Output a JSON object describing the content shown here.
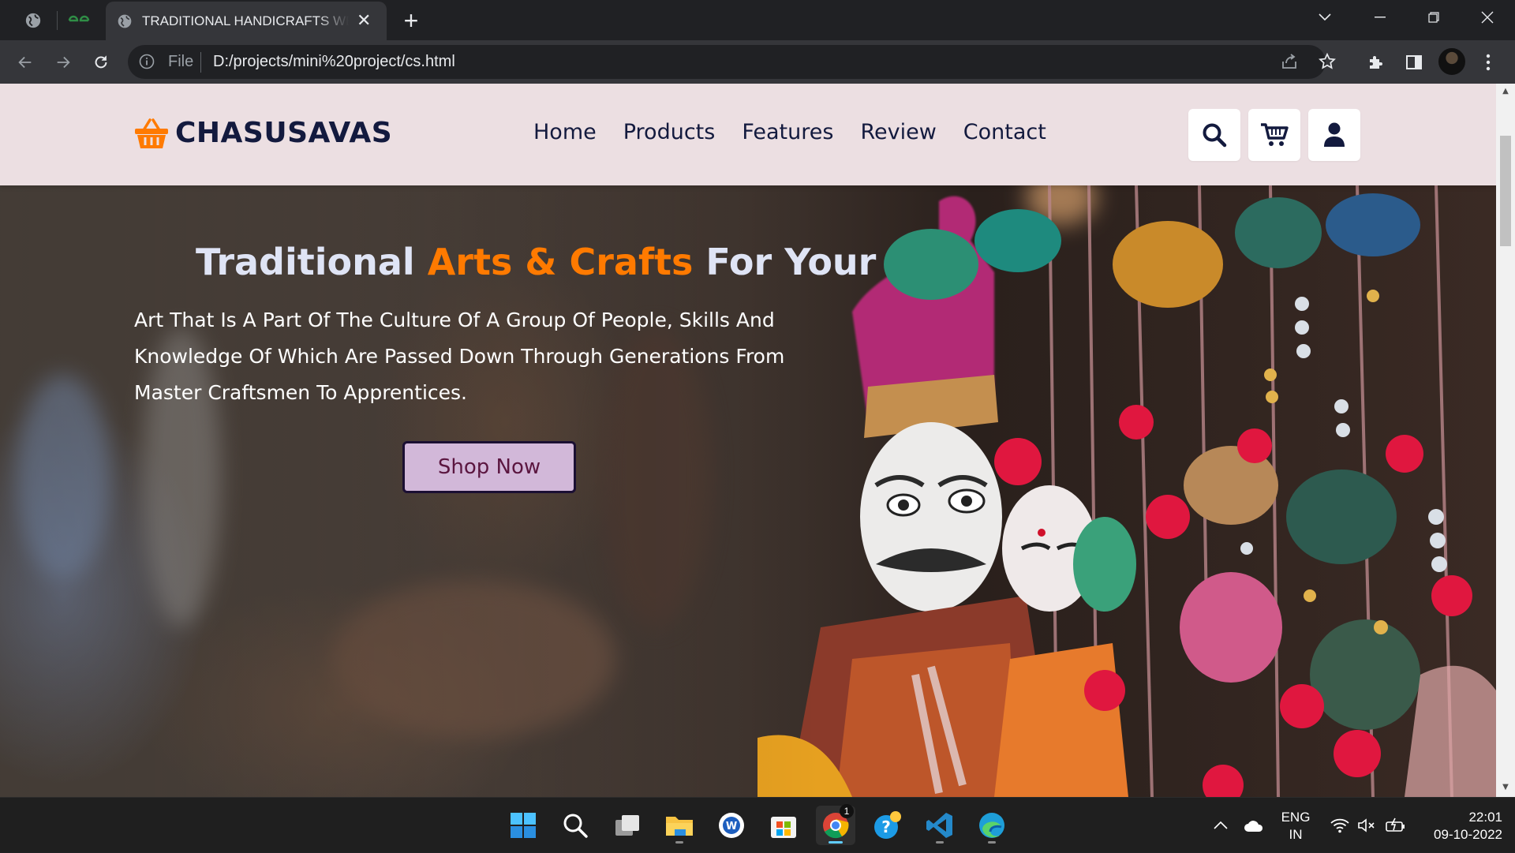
{
  "browser": {
    "active_tab": {
      "title": "TRADITIONAL HANDICRAFTS WEBSITE",
      "favicon": "globe-icon"
    },
    "address": {
      "scheme_label": "File",
      "url": "D:/projects/mini%20project/cs.html"
    }
  },
  "site": {
    "brand": "CHASUSAVAS",
    "nav": [
      "Home",
      "Products",
      "Features",
      "Review",
      "Contact"
    ],
    "colors": {
      "header_bg": "#ecdfe2",
      "brand_text": "#131a3e",
      "accent": "#ff7a00",
      "button_bg": "#d2b8d9"
    },
    "hero": {
      "title_part1": "Traditional ",
      "title_accent": "Arts & Crafts",
      "title_part2": " For Your",
      "description": "Art That Is A Part Of The Culture Of A Group Of People, Skills And Knowledge Of Which Are Passed Down Through Generations From Master Craftsmen To Apprentices.",
      "cta": "Shop Now"
    }
  },
  "taskbar": {
    "apps": [
      "start-icon",
      "search-icon",
      "task-view-icon",
      "file-explorer-icon",
      "app-w-icon",
      "store-icon",
      "chrome-icon",
      "help-icon",
      "vscode-icon",
      "edge-icon"
    ],
    "chrome_badge": "1",
    "lang_line1": "ENG",
    "lang_line2": "IN",
    "time": "22:01",
    "date": "09-10-2022"
  }
}
